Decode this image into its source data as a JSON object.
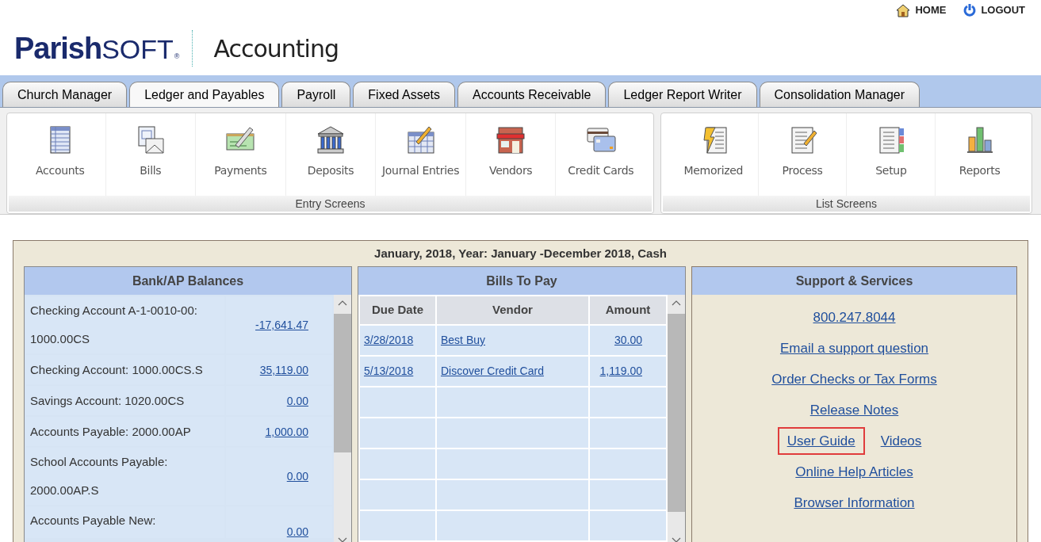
{
  "header": {
    "logo_left": "Parish",
    "logo_right": "SOFT",
    "logo_mark": "®",
    "product": "Accounting",
    "links": [
      {
        "kind": "home",
        "label": "HOME"
      },
      {
        "kind": "logout",
        "label": "LOGOUT"
      }
    ]
  },
  "tabs": [
    {
      "label": "Church Manager",
      "selected": false
    },
    {
      "label": "Ledger and Payables",
      "selected": true
    },
    {
      "label": "Payroll",
      "selected": false
    },
    {
      "label": "Fixed Assets",
      "selected": false
    },
    {
      "label": "Accounts Receivable",
      "selected": false
    },
    {
      "label": "Ledger Report Writer",
      "selected": false
    },
    {
      "label": "Consolidation Manager",
      "selected": false
    }
  ],
  "toolbar_groups": [
    {
      "title": "Entry Screens",
      "items": [
        {
          "kind": "accounts",
          "label": "Accounts"
        },
        {
          "kind": "bills",
          "label": "Bills"
        },
        {
          "kind": "payments",
          "label": "Payments"
        },
        {
          "kind": "deposits",
          "label": "Deposits"
        },
        {
          "kind": "journal",
          "label": "Journal Entries"
        },
        {
          "kind": "vendors",
          "label": "Vendors"
        },
        {
          "kind": "cards",
          "label": "Credit Cards"
        }
      ]
    },
    {
      "title": "List Screens",
      "items": [
        {
          "kind": "memorized",
          "label": "Memorized"
        },
        {
          "kind": "process",
          "label": "Process"
        },
        {
          "kind": "setup",
          "label": "Setup"
        },
        {
          "kind": "reports",
          "label": "Reports"
        }
      ]
    }
  ],
  "period": "January, 2018, Year: January -December 2018, Cash",
  "bank_balances": {
    "title": "Bank/AP Balances",
    "rows": [
      {
        "account": "Checking Account A-1-0010-00: 1000.00CS",
        "amount": "-17,641.47"
      },
      {
        "account": "Checking Account: 1000.00CS.S",
        "amount": "35,119.00"
      },
      {
        "account": "Savings Account: 1020.00CS",
        "amount": "0.00"
      },
      {
        "account": "Accounts Payable: 2000.00AP",
        "amount": "1,000.00"
      },
      {
        "account": "School Accounts Payable: 2000.00AP.S",
        "amount": "0.00"
      },
      {
        "account": "Accounts Payable New:",
        "amount": "0.00"
      }
    ]
  },
  "bills_to_pay": {
    "title": "Bills To Pay",
    "columns": [
      "Due Date",
      "Vendor",
      "Amount"
    ],
    "rows": [
      {
        "due_date": "3/28/2018",
        "vendor": "Best Buy",
        "amount": "30.00"
      },
      {
        "due_date": "5/13/2018",
        "vendor": "Discover Credit Card",
        "amount": "1,119.00"
      }
    ]
  },
  "support": {
    "title": "Support & Services",
    "links": [
      [
        {
          "label": "800.247.8044",
          "highlighted": false
        }
      ],
      [
        {
          "label": "Email a support question",
          "highlighted": false
        }
      ],
      [
        {
          "label": "Order Checks or Tax Forms",
          "highlighted": false
        }
      ],
      [
        {
          "label": "Release Notes",
          "highlighted": false
        }
      ],
      [
        {
          "label": "User Guide",
          "highlighted": true
        },
        {
          "label": "Videos",
          "highlighted": false
        }
      ],
      [
        {
          "label": "Online Help Articles",
          "highlighted": false
        }
      ],
      [
        {
          "label": "Browser Information",
          "highlighted": false
        }
      ]
    ]
  }
}
